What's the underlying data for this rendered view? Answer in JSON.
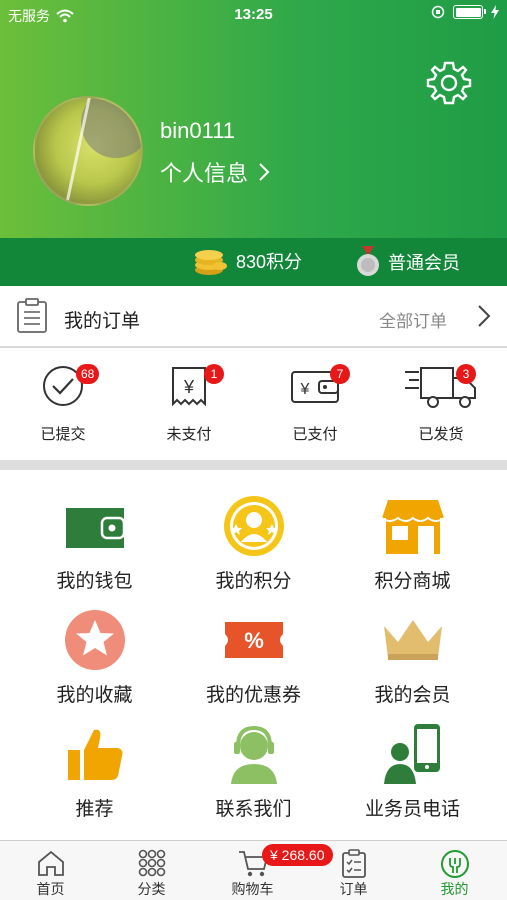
{
  "status_bar": {
    "carrier": "无服务",
    "time": "13:25"
  },
  "profile": {
    "username": "bin0111",
    "info_link": "个人信息"
  },
  "points_bar": {
    "points": "830积分",
    "member_level": "普通会员"
  },
  "orders": {
    "title": "我的订单",
    "all_link": "全部订单",
    "statuses": [
      {
        "label": "已提交",
        "count": "68",
        "icon": "check-circle-icon"
      },
      {
        "label": "未支付",
        "count": "1",
        "icon": "receipt-yen-icon"
      },
      {
        "label": "已支付",
        "count": "7",
        "icon": "wallet-yen-icon"
      },
      {
        "label": "已发货",
        "count": "3",
        "icon": "delivery-truck-icon"
      }
    ]
  },
  "menu": [
    {
      "label": "我的钱包",
      "icon": "wallet-icon"
    },
    {
      "label": "我的积分",
      "icon": "points-medal-icon"
    },
    {
      "label": "积分商城",
      "icon": "store-icon"
    },
    {
      "label": "我的收藏",
      "icon": "star-icon"
    },
    {
      "label": "我的优惠券",
      "icon": "coupon-icon"
    },
    {
      "label": "我的会员",
      "icon": "crown-icon"
    },
    {
      "label": "推荐",
      "icon": "thumbs-up-icon"
    },
    {
      "label": "联系我们",
      "icon": "customer-service-icon"
    },
    {
      "label": "业务员电话",
      "icon": "salesman-phone-icon"
    }
  ],
  "tabbar": {
    "tabs": [
      {
        "label": "首页",
        "icon": "home-icon"
      },
      {
        "label": "分类",
        "icon": "category-grid-icon"
      },
      {
        "label": "购物车",
        "icon": "cart-icon"
      },
      {
        "label": "订单",
        "icon": "order-list-icon"
      },
      {
        "label": "我的",
        "icon": "profile-icon"
      }
    ],
    "cart_total": "¥ 268.60",
    "active_tab": "我的"
  },
  "colors": {
    "header_start": "#6cbf3a",
    "header_end": "#1f9c46",
    "points_bar": "#12873a",
    "badge": "#e81818",
    "active_tab": "#1f9c2f"
  }
}
